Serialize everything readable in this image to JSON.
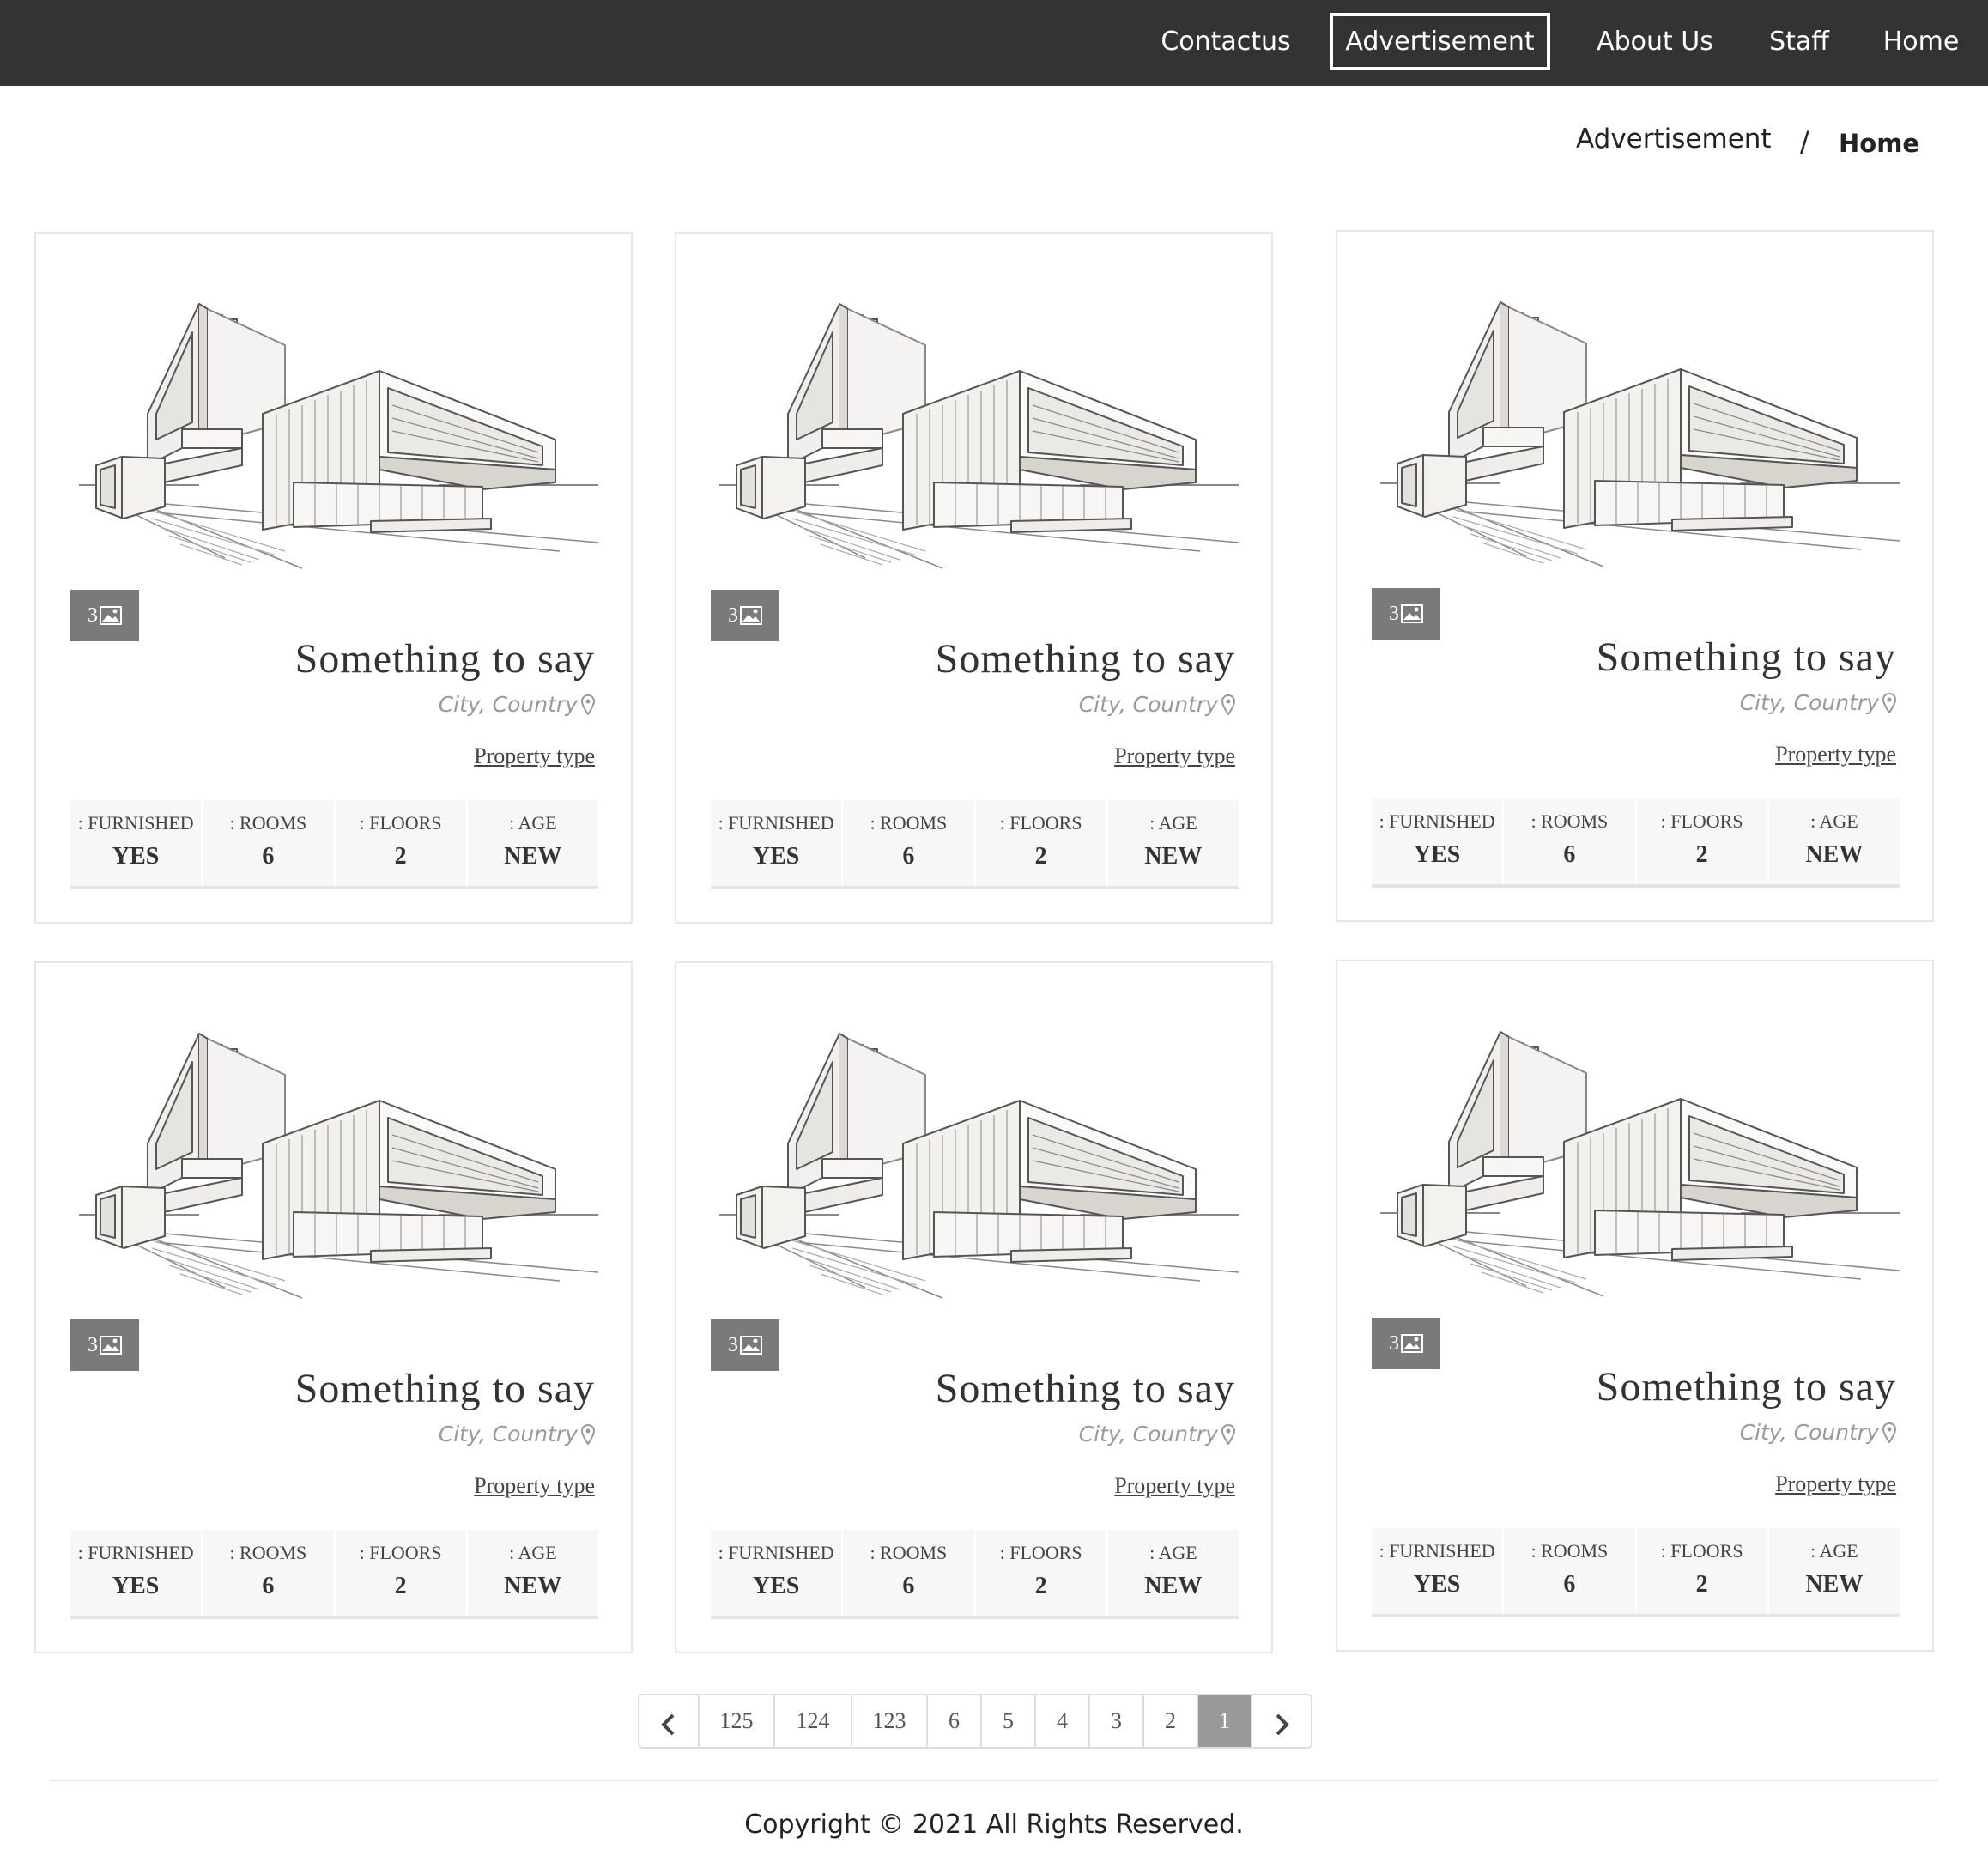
{
  "nav": {
    "items": [
      "Contactus",
      "Advertisement",
      "About Us",
      "Staff",
      "Home"
    ],
    "active": "Advertisement"
  },
  "breadcrumb": {
    "current": "Advertisement",
    "separator": "/",
    "home": "Home"
  },
  "listings": [
    {
      "photo_count": "3",
      "title": "Something to say",
      "location": "City, Country",
      "type": "Property type",
      "specs": {
        "furnished_label": ": FURNISHED",
        "furnished": "YES",
        "rooms_label": ": ROOMS",
        "rooms": "6",
        "floors_label": ": FLOORS",
        "floors": "2",
        "age_label": ": AGE",
        "age": "NEW"
      }
    },
    {
      "photo_count": "3",
      "title": "Something to say",
      "location": "City, Country",
      "type": "Property type",
      "specs": {
        "furnished_label": ": FURNISHED",
        "furnished": "YES",
        "rooms_label": ": ROOMS",
        "rooms": "6",
        "floors_label": ": FLOORS",
        "floors": "2",
        "age_label": ": AGE",
        "age": "NEW"
      }
    },
    {
      "photo_count": "3",
      "title": "Something to say",
      "location": "City, Country",
      "type": "Property type",
      "specs": {
        "furnished_label": ": FURNISHED",
        "furnished": "YES",
        "rooms_label": ": ROOMS",
        "rooms": "6",
        "floors_label": ": FLOORS",
        "floors": "2",
        "age_label": ": AGE",
        "age": "NEW"
      }
    },
    {
      "photo_count": "3",
      "title": "Something to say",
      "location": "City, Country",
      "type": "Property type",
      "specs": {
        "furnished_label": ": FURNISHED",
        "furnished": "YES",
        "rooms_label": ": ROOMS",
        "rooms": "6",
        "floors_label": ": FLOORS",
        "floors": "2",
        "age_label": ": AGE",
        "age": "NEW"
      }
    },
    {
      "photo_count": "3",
      "title": "Something to say",
      "location": "City, Country",
      "type": "Property type",
      "specs": {
        "furnished_label": ": FURNISHED",
        "furnished": "YES",
        "rooms_label": ": ROOMS",
        "rooms": "6",
        "floors_label": ": FLOORS",
        "floors": "2",
        "age_label": ": AGE",
        "age": "NEW"
      }
    },
    {
      "photo_count": "3",
      "title": "Something to say",
      "location": "City, Country",
      "type": "Property type",
      "specs": {
        "furnished_label": ": FURNISHED",
        "furnished": "YES",
        "rooms_label": ": ROOMS",
        "rooms": "6",
        "floors_label": ": FLOORS",
        "floors": "2",
        "age_label": ": AGE",
        "age": "NEW"
      }
    }
  ],
  "pagination": {
    "prev_icon": "chevron-left-icon",
    "pages": [
      "125",
      "124",
      "123",
      "6",
      "5",
      "4",
      "3",
      "2",
      "1"
    ],
    "active": "1",
    "next_icon": "chevron-right-icon"
  },
  "footer": {
    "copyright": "Copyright © 2021 All Rights Reserved."
  },
  "icons": {
    "photo": "image-icon",
    "location": "map-pin-icon"
  },
  "colors": {
    "navbar": "#333333",
    "badge": "#7a7a7a",
    "active_page": "#999999"
  }
}
